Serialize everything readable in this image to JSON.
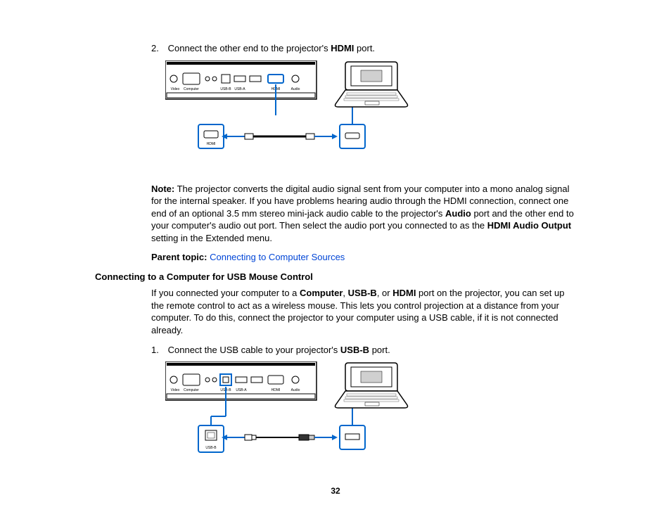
{
  "step2": {
    "num": "2.",
    "prefix": "Connect the other end to the projector's ",
    "bold": "HDMI",
    "suffix": " port."
  },
  "figure1": {
    "ports": [
      "Video",
      "Computer",
      "USB-B",
      "USB-A",
      "HDMI",
      "Audio"
    ],
    "callout_label": "HDMI"
  },
  "note": {
    "label": "Note:",
    "part1": " The projector converts the digital audio signal sent from your computer into a mono analog signal for the internal speaker. If you have problems hearing audio through the HDMI connection, connect one end of an optional 3.5 mm stereo mini-jack audio cable to the projector's ",
    "bold1": "Audio",
    "part2": " port and the other end to your computer's audio out port. Then select the audio port you connected to as the ",
    "bold2": "HDMI Audio Output",
    "part3": " setting in the Extended menu."
  },
  "parent": {
    "label": "Parent topic:",
    "link": "Connecting to Computer Sources"
  },
  "section_title": "Connecting to a Computer for USB Mouse Control",
  "intro": {
    "p1": "If you connected your computer to a ",
    "b1": "Computer",
    "sep1": ", ",
    "b2": "USB-B",
    "sep2": ", or ",
    "b3": "HDMI",
    "p2": " port on the projector, you can set up the remote control to act as a wireless mouse. This lets you control projection at a distance from your computer. To do this, connect the projector to your computer using a USB cable, if it is not connected already."
  },
  "step1": {
    "num": "1.",
    "prefix": "Connect the USB cable to your projector's ",
    "bold": "USB-B",
    "suffix": " port."
  },
  "figure2": {
    "ports": [
      "Video",
      "Computer",
      "USB-B",
      "USB-A",
      "HDMI",
      "Audio"
    ],
    "callout_label": "USB-B"
  },
  "page_number": "32"
}
